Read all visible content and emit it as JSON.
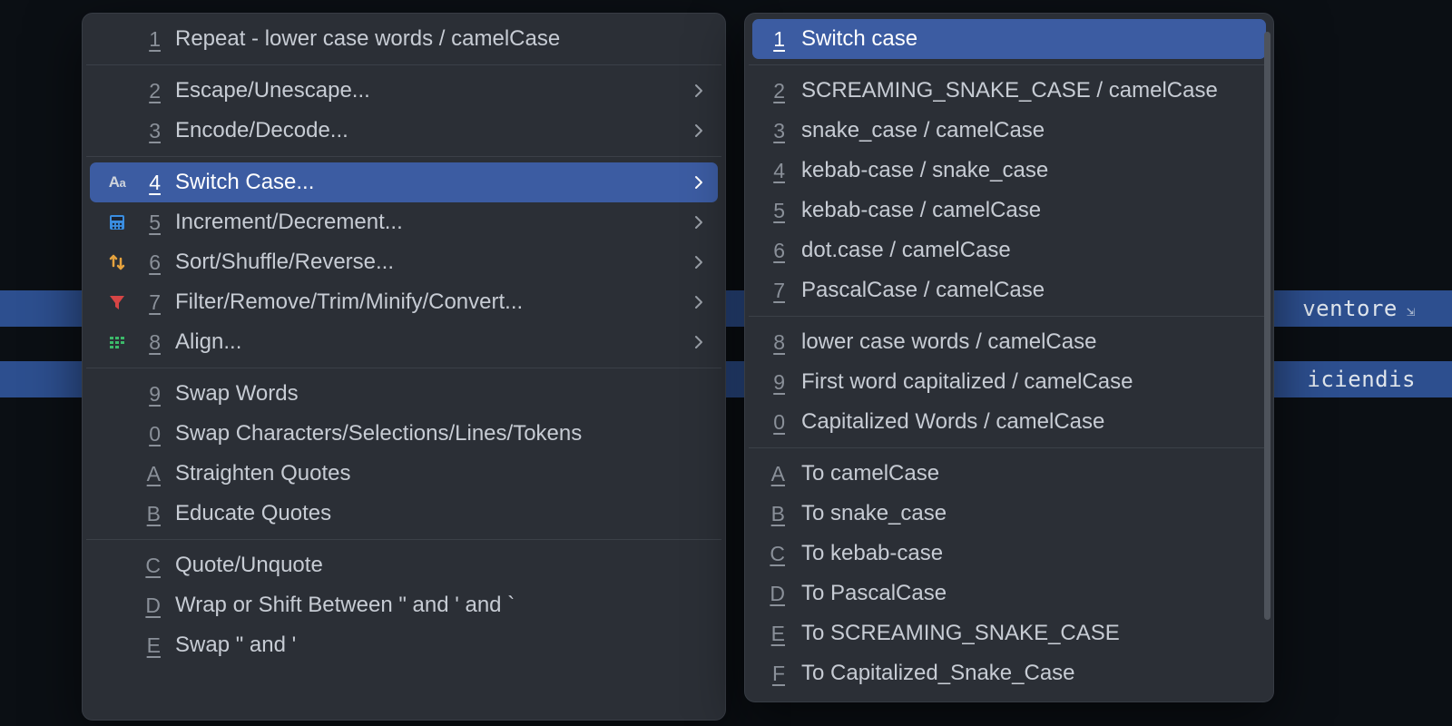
{
  "editor": {
    "line1_fragment": "ventore",
    "line2_fragment": "iciendis",
    "selection_top_1": 320,
    "selection_top_2": 398
  },
  "left_menu": {
    "groups": [
      [
        {
          "key": "1",
          "label": "Repeat - lower case words / camelCase",
          "icon": "",
          "submenu": false
        }
      ],
      [
        {
          "key": "2",
          "label": "Escape/Unescape...",
          "icon": "",
          "submenu": true
        },
        {
          "key": "3",
          "label": "Encode/Decode...",
          "icon": "",
          "submenu": true
        }
      ],
      [
        {
          "key": "4",
          "label": "Switch Case...",
          "icon": "aa",
          "submenu": true,
          "selected": true
        },
        {
          "key": "5",
          "label": "Increment/Decrement...",
          "icon": "calc",
          "submenu": true
        },
        {
          "key": "6",
          "label": "Sort/Shuffle/Reverse...",
          "icon": "sort",
          "submenu": true
        },
        {
          "key": "7",
          "label": "Filter/Remove/Trim/Minify/Convert...",
          "icon": "filter",
          "submenu": true
        },
        {
          "key": "8",
          "label": "Align...",
          "icon": "align",
          "submenu": true
        }
      ],
      [
        {
          "key": "9",
          "label": "Swap Words",
          "icon": "",
          "submenu": false
        },
        {
          "key": "0",
          "label": "Swap Characters/Selections/Lines/Tokens",
          "icon": "",
          "submenu": false
        },
        {
          "key": "A",
          "label": "Straighten Quotes",
          "icon": "",
          "submenu": false
        },
        {
          "key": "B",
          "label": "Educate Quotes",
          "icon": "",
          "submenu": false
        }
      ],
      [
        {
          "key": "C",
          "label": "Quote/Unquote",
          "icon": "",
          "submenu": false
        },
        {
          "key": "D",
          "label": "Wrap or Shift Between \" and ' and `",
          "icon": "",
          "submenu": false
        },
        {
          "key": "E",
          "label": "Swap \" and '",
          "icon": "",
          "submenu": false
        }
      ]
    ]
  },
  "right_menu": {
    "groups": [
      [
        {
          "key": "1",
          "label": "Switch case",
          "selected": true
        }
      ],
      [
        {
          "key": "2",
          "label": "SCREAMING_SNAKE_CASE / camelCase"
        },
        {
          "key": "3",
          "label": "snake_case / camelCase"
        },
        {
          "key": "4",
          "label": "kebab-case / snake_case"
        },
        {
          "key": "5",
          "label": "kebab-case / camelCase"
        },
        {
          "key": "6",
          "label": "dot.case / camelCase"
        },
        {
          "key": "7",
          "label": "PascalCase / camelCase"
        }
      ],
      [
        {
          "key": "8",
          "label": "lower case words / camelCase"
        },
        {
          "key": "9",
          "label": "First word capitalized / camelCase"
        },
        {
          "key": "0",
          "label": "Capitalized Words / camelCase"
        }
      ],
      [
        {
          "key": "A",
          "label": "To camelCase"
        },
        {
          "key": "B",
          "label": "To snake_case"
        },
        {
          "key": "C",
          "label": "To kebab-case"
        },
        {
          "key": "D",
          "label": "To PascalCase"
        },
        {
          "key": "E",
          "label": "To SCREAMING_SNAKE_CASE"
        },
        {
          "key": "F",
          "label": "To Capitalized_Snake_Case"
        }
      ]
    ]
  }
}
